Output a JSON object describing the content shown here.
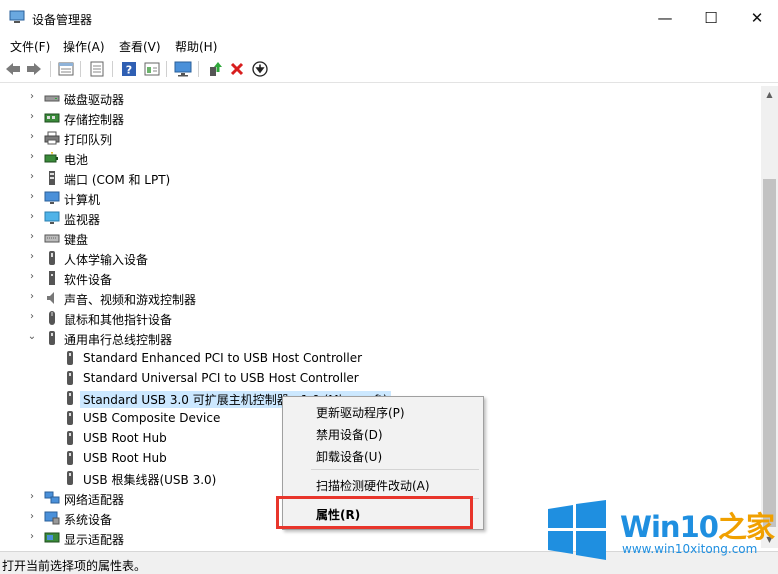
{
  "window": {
    "title": "设备管理器",
    "minimize": "—",
    "maximize": "☐",
    "close": "✕"
  },
  "menu": [
    {
      "label": "文件(F)"
    },
    {
      "label": "操作(A)"
    },
    {
      "label": "查看(V)"
    },
    {
      "label": "帮助(H)"
    }
  ],
  "toolbar": {
    "buttons": [
      "back-icon",
      "forward-icon",
      "properties-icon",
      "list-icon",
      "help-icon",
      "view-icon",
      "monitor-icon",
      "update-driver-icon",
      "uninstall-icon",
      "download-icon"
    ]
  },
  "tree": [
    {
      "label": "磁盘驱动器",
      "icon": "disk-drive-icon",
      "expander": "›",
      "level": 0
    },
    {
      "label": "存储控制器",
      "icon": "storage-controller-icon",
      "expander": "›",
      "level": 0
    },
    {
      "label": "打印队列",
      "icon": "printer-icon",
      "expander": "›",
      "level": 0
    },
    {
      "label": "电池",
      "icon": "battery-icon",
      "expander": "›",
      "level": 0
    },
    {
      "label": "端口 (COM 和 LPT)",
      "icon": "port-icon",
      "expander": "›",
      "level": 0
    },
    {
      "label": "计算机",
      "icon": "computer-icon",
      "expander": "›",
      "level": 0
    },
    {
      "label": "监视器",
      "icon": "monitor-icon",
      "expander": "›",
      "level": 0
    },
    {
      "label": "键盘",
      "icon": "keyboard-icon",
      "expander": "›",
      "level": 0
    },
    {
      "label": "人体学输入设备",
      "icon": "hid-icon",
      "expander": "›",
      "level": 0
    },
    {
      "label": "软件设备",
      "icon": "software-device-icon",
      "expander": "›",
      "level": 0
    },
    {
      "label": "声音、视频和游戏控制器",
      "icon": "speaker-icon",
      "expander": "›",
      "level": 0
    },
    {
      "label": "鼠标和其他指针设备",
      "icon": "mouse-icon",
      "expander": "›",
      "level": 0
    },
    {
      "label": "通用串行总线控制器",
      "icon": "usb-icon",
      "expander": "⌄",
      "level": 0
    },
    {
      "label": "Standard Enhanced PCI to USB Host Controller",
      "icon": "usb-icon",
      "expander": "",
      "level": 1
    },
    {
      "label": "Standard Universal PCI to USB Host Controller",
      "icon": "usb-icon",
      "expander": "",
      "level": 1
    },
    {
      "label": "Standard USB 3.0 可扩展主机控制器 - 1.0 (Microsoft)",
      "icon": "usb-icon",
      "expander": "",
      "level": 1,
      "selected": true
    },
    {
      "label": "USB Composite Device",
      "icon": "usb-icon",
      "expander": "",
      "level": 1
    },
    {
      "label": "USB Root Hub",
      "icon": "usb-icon",
      "expander": "",
      "level": 1
    },
    {
      "label": "USB Root Hub",
      "icon": "usb-icon",
      "expander": "",
      "level": 1
    },
    {
      "label": "USB 根集线器(USB 3.0)",
      "icon": "usb-icon",
      "expander": "",
      "level": 1
    },
    {
      "label": "网络适配器",
      "icon": "network-adapter-icon",
      "expander": "›",
      "level": 0
    },
    {
      "label": "系统设备",
      "icon": "system-device-icon",
      "expander": "›",
      "level": 0
    },
    {
      "label": "显示适配器",
      "icon": "display-adapter-icon",
      "expander": "›",
      "level": 0
    }
  ],
  "context_menu": {
    "items": [
      {
        "label": "更新驱动程序(P)"
      },
      {
        "label": "禁用设备(D)"
      },
      {
        "label": "卸载设备(U)"
      },
      {
        "label": "扫描检测硬件改动(A)"
      },
      {
        "label": "属性(R)"
      }
    ]
  },
  "status": {
    "text": "打开当前选择项的属性表。"
  },
  "watermark": {
    "brand_a": "Win10",
    "brand_b": "之家",
    "site": "www.win10xitong.com"
  },
  "colors": {
    "selection": "#cce8ff",
    "highlight_box": "#e8352b",
    "logo_blue": "#1f8fe0",
    "logo_orange": "#f0a000"
  }
}
